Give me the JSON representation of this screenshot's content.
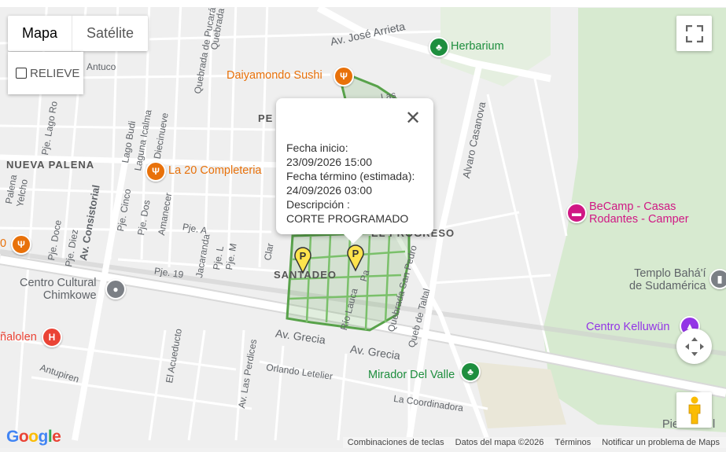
{
  "map_type": {
    "map": "Mapa",
    "satellite": "Satélite",
    "relief": "RELIEVE"
  },
  "popup": {
    "lines": [
      "Fecha inicio:",
      "23/09/2026 15:00",
      "Fecha término (estimada):",
      "24/09/2026 03:00",
      "Descripción :",
      "CORTE PROGRAMADO"
    ]
  },
  "places": {
    "herbarium": "Herbarium",
    "daiyamondo": "Daiyamondo Sushi",
    "la20": "La 20 Completeria",
    "becamp1": "BeCamp - Casas",
    "becamp2": "Rodantes - Camper",
    "templo1": "Templo Bahá'í",
    "templo2": "de Sudamérica",
    "kelluwun": "Centro Kelluwün",
    "mirador": "Mirador Del Valle",
    "chimkowe1": "Centro Cultural",
    "chimkowe2": "Chimkowe",
    "penalolen": "ñalolen"
  },
  "areas": {
    "nueva_palena": "NUEVA PALENA",
    "santadeo": "SANTADEO",
    "progreso": "EL PROGRESO",
    "pe": "PE"
  },
  "streets": {
    "jose_arrieta": "Av. José Arrieta",
    "grecia1": "Av. Grecia",
    "grecia2": "Av. Grecia",
    "alvaro_casanova": "Alvaro Casanova",
    "consistorial": "Av. Consistorial",
    "antuco": "Antuco",
    "lago_budi": "Lago Budi",
    "laguna_icalma": "Laguna Icalma",
    "c_diecinueve": "C. Diecinueve",
    "pje_lago_ro": "Pje. Lago Ro",
    "quebrada_pucara": "Quebrada de Pucará",
    "quebrada_la": "Quebrada de la",
    "pje_cinco": "Pje. Cinco",
    "pje_dos": "Pje. Dos",
    "amanecer": "Amanecer",
    "pje_doce": "Pje. Doce",
    "pje_diez": "Pje. Diez",
    "pje_a": "Pje. A",
    "pje_l": "Pje. L",
    "pje_m": "Pje. M",
    "jacaranda": "Jacaranda",
    "pje_19": "Pje. 19",
    "palena": "Palena",
    "yelcho": "Yelcho",
    "rio_lauca": "Río Lauca",
    "quebrada_san_pedro": "Quebrada San Pedro",
    "queb_taltal": "Queb de Taltal",
    "el_acueducto": "El Acueducto",
    "las_perdices": "Av. Las Perdices",
    "orlando_letelier": "Orlando Letelier",
    "antupiren": "Antupiren",
    "la_coordinadora": "La Coordinadora",
    "pie": "Pie",
    "pie_tail": "l",
    "las": "Las",
    "clar": "Clar",
    "pa": "Pa",
    "zero": "0"
  },
  "markers": [
    {
      "name": "parking-marker-1",
      "label": "P"
    },
    {
      "name": "parking-marker-2",
      "label": "P"
    }
  ],
  "footer": {
    "shortcuts": "Combinaciones de teclas",
    "data": "Datos del mapa ©2026",
    "terms": "Términos",
    "report": "Notificar un problema de Maps"
  },
  "logo": {
    "g1": "G",
    "o1": "o",
    "o2": "o",
    "g2": "g",
    "l": "l",
    "e": "e"
  },
  "colors": {
    "outage_area": "#58a24a",
    "park": "#d7ead0",
    "poi_orange": "#e8710a",
    "poi_green": "#1e8e3e",
    "poi_pink": "#d01884",
    "poi_red": "#ea4335",
    "poi_purple": "#9334e6",
    "marker_yellow": "#ffe34d"
  },
  "icons": [
    "fullscreen-icon",
    "close-icon",
    "camera-control-icon",
    "pegman-icon",
    "restaurant-icon",
    "park-icon",
    "lodging-icon",
    "worship-icon",
    "hospital-icon",
    "museum-icon"
  ]
}
